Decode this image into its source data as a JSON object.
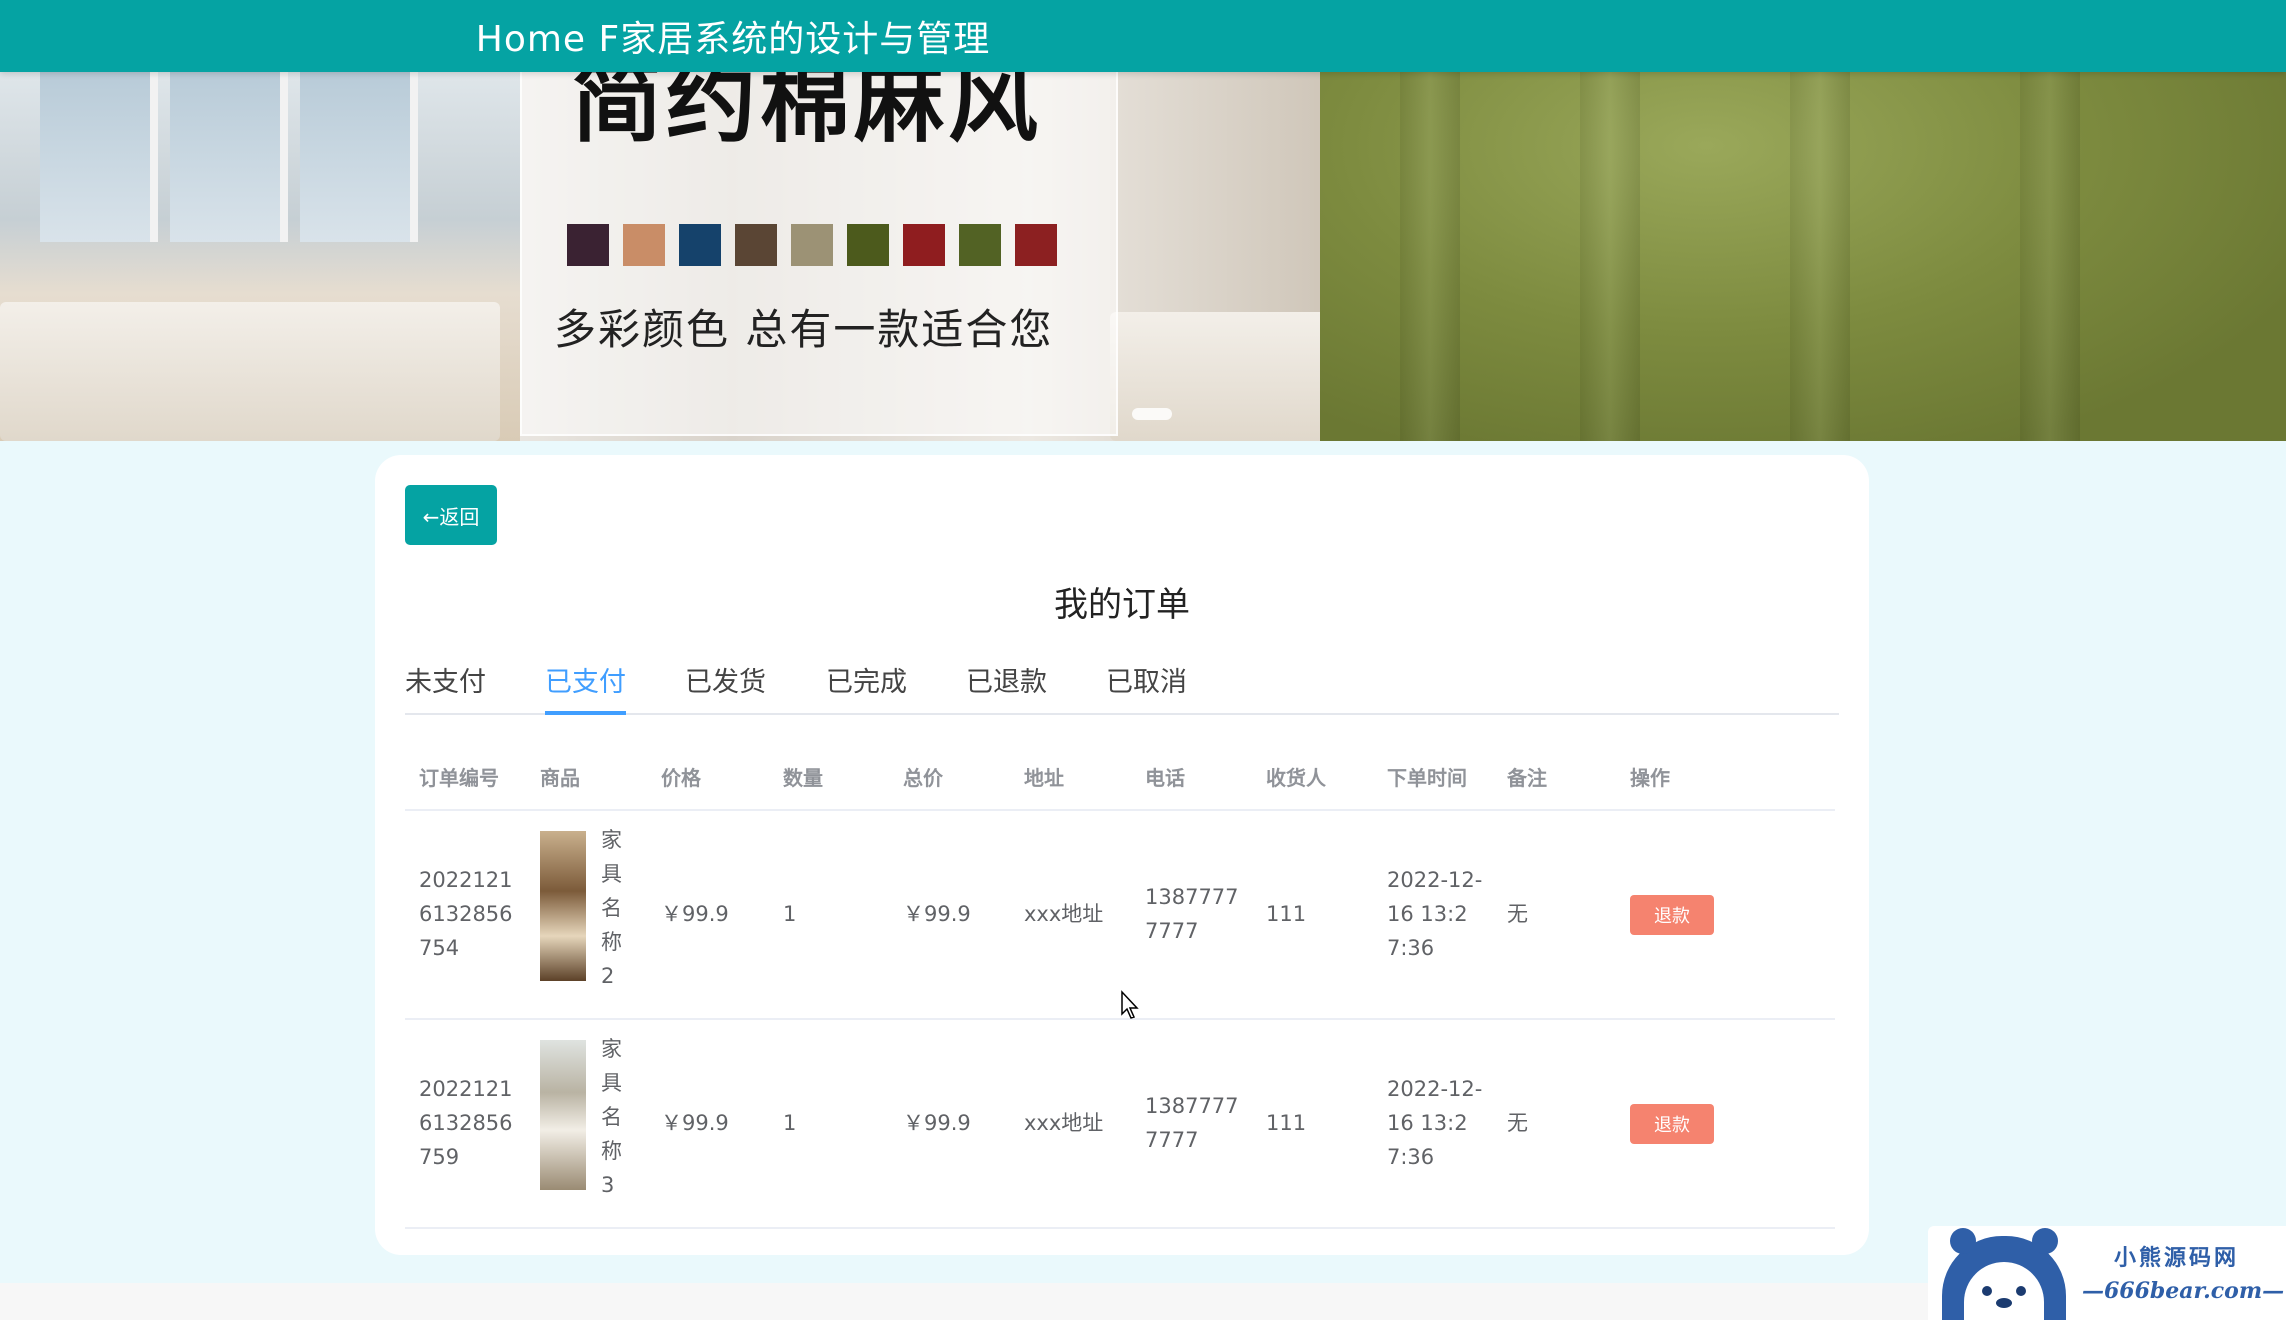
{
  "header": {
    "title": "Home F家居系统的设计与管理"
  },
  "banner": {
    "headline": "简约棉麻风",
    "slogan": "多彩颜色  总有一款适合您",
    "swatch_colors": [
      "#3a2232",
      "#c98d67",
      "#15426b",
      "#5a4534",
      "#9c9275",
      "#4c5a1c",
      "#8f1d1f",
      "#526224",
      "#8c2021"
    ]
  },
  "back_button": {
    "label": "←返回"
  },
  "page_title": "我的订单",
  "tabs": [
    {
      "label": "未支付"
    },
    {
      "label": "已支付",
      "active": true
    },
    {
      "label": "已发货"
    },
    {
      "label": "已完成"
    },
    {
      "label": "已退款"
    },
    {
      "label": "已取消"
    }
  ],
  "table": {
    "headers": [
      "订单编号",
      "商品",
      "价格",
      "数量",
      "总价",
      "地址",
      "电话",
      "收货人",
      "下单时间",
      "备注",
      "操作"
    ],
    "rows": [
      {
        "id": "20221216132856754",
        "product_name": "家具名称2",
        "price": "￥99.9",
        "qty": "1",
        "total": "￥99.9",
        "address": "xxx地址",
        "phone": "13877777777",
        "receiver": "111",
        "time": "2022-12-16 13:27:36",
        "note": "无",
        "action": "退款"
      },
      {
        "id": "20221216132856759",
        "product_name": "家具名称3",
        "price": "￥99.9",
        "qty": "1",
        "total": "￥99.9",
        "address": "xxx地址",
        "phone": "13877777777",
        "receiver": "111",
        "time": "2022-12-16 13:27:36",
        "note": "无",
        "action": "退款"
      }
    ]
  },
  "watermark": {
    "name": "小熊源码网",
    "url": "—666bear.com—"
  },
  "colors": {
    "primary": "#05a3a3",
    "tab_active": "#409eff",
    "refund": "#f5836f"
  }
}
